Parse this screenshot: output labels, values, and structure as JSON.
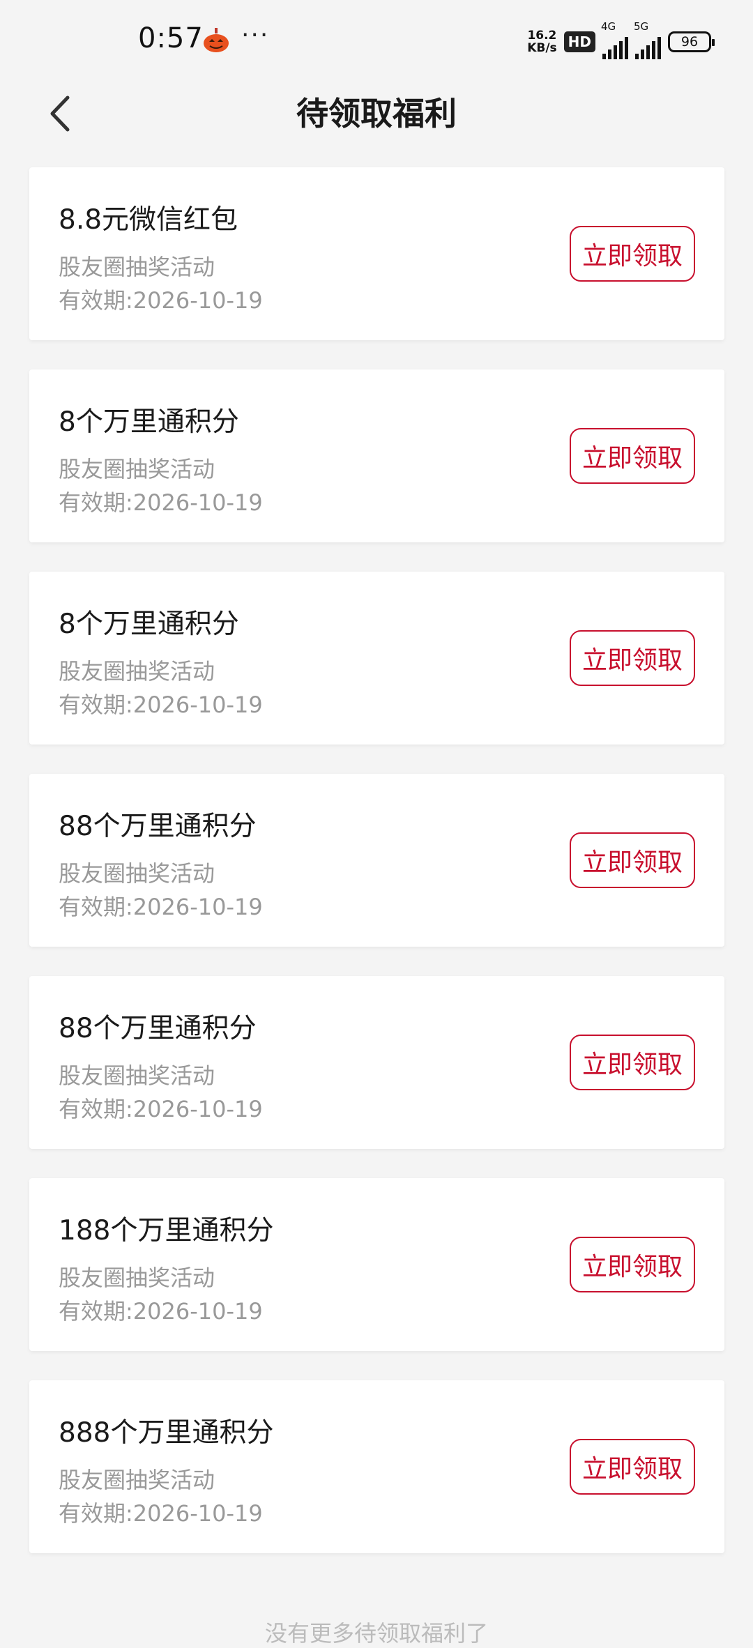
{
  "status_bar": {
    "time": "0:57",
    "dots": "···",
    "net_speed_value": "16.2",
    "net_speed_unit": "KB/s",
    "hd_badge": "HD",
    "sig1_label": "4G",
    "sig2_label": "5G",
    "battery": "96"
  },
  "nav": {
    "title": "待领取福利"
  },
  "cards": [
    {
      "title": "8.8元微信红包",
      "source": "股友圈抽奖活动",
      "expiry": "有效期:2026-10-19",
      "button": "立即领取"
    },
    {
      "title": "8个万里通积分",
      "source": "股友圈抽奖活动",
      "expiry": "有效期:2026-10-19",
      "button": "立即领取"
    },
    {
      "title": "8个万里通积分",
      "source": "股友圈抽奖活动",
      "expiry": "有效期:2026-10-19",
      "button": "立即领取"
    },
    {
      "title": "88个万里通积分",
      "source": "股友圈抽奖活动",
      "expiry": "有效期:2026-10-19",
      "button": "立即领取"
    },
    {
      "title": "88个万里通积分",
      "source": "股友圈抽奖活动",
      "expiry": "有效期:2026-10-19",
      "button": "立即领取"
    },
    {
      "title": "188个万里通积分",
      "source": "股友圈抽奖活动",
      "expiry": "有效期:2026-10-19",
      "button": "立即领取"
    },
    {
      "title": "888个万里通积分",
      "source": "股友圈抽奖活动",
      "expiry": "有效期:2026-10-19",
      "button": "立即领取"
    }
  ],
  "footer": {
    "text": "没有更多待领取福利了"
  },
  "colors": {
    "accent": "#c8102e",
    "background": "#f4f4f4",
    "secondary_text": "#999999"
  },
  "icons": {
    "back": "chevron-left-icon",
    "app": "pumpkin-app-icon"
  }
}
